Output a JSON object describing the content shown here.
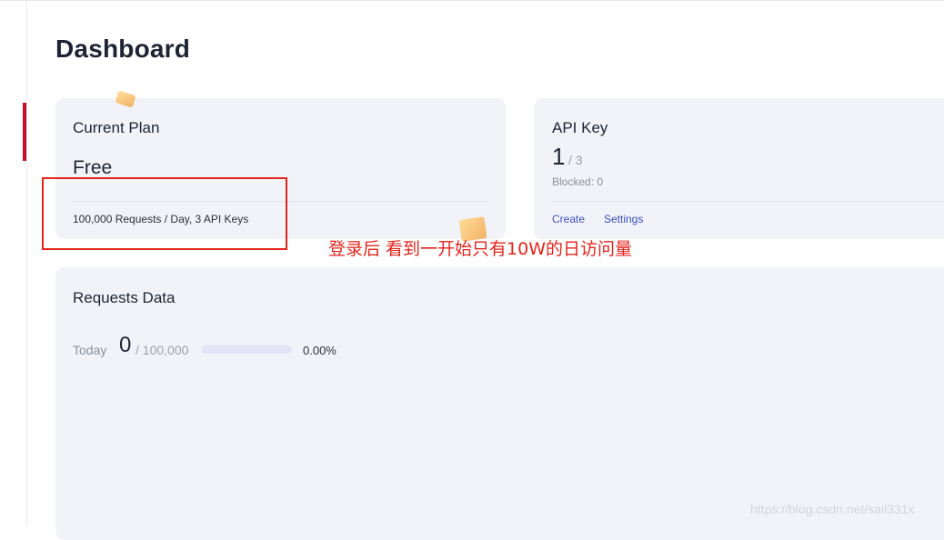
{
  "page": {
    "title": "Dashboard"
  },
  "plan_card": {
    "heading": "Current Plan",
    "plan_name": "Free",
    "description": "100,000 Requests / Day, 3 API Keys"
  },
  "api_key_card": {
    "heading": "API Key",
    "count": "1",
    "total": "/ 3",
    "blocked": "Blocked: 0",
    "links": {
      "create": "Create",
      "settings": "Settings"
    }
  },
  "requests_card": {
    "heading": "Requests Data",
    "today_label": "Today",
    "today_count": "0",
    "today_limit": "/ 100,000",
    "progress_fraction": 0,
    "progress_text": "0.00%"
  },
  "annotation": {
    "text": "登录后 看到一开始只有10W的日访问量",
    "color": "#e3241b"
  },
  "watermark": "https://blog.csdn.net/sail331x",
  "colors": {
    "accent": "#c8102e",
    "link": "#3b4fc4",
    "card_bg": "#f1f3f8",
    "progress_track": "#e3e5f7"
  }
}
